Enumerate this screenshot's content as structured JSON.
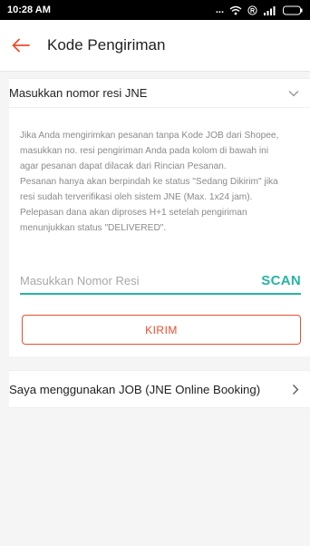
{
  "status_bar": {
    "time": "10:28 AM",
    "dots": "..."
  },
  "header": {
    "title": "Kode Pengiriman"
  },
  "section": {
    "dropdown_label": "Masukkan nomor resi JNE",
    "info_lines": [
      "Jika Anda mengirimkan pesanan tanpa Kode JOB dari Shopee,",
      "masukkan no. resi pengiriman Anda pada kolom di bawah ini",
      "agar pesanan dapat dilacak dari Rincian Pesanan.",
      "Pesanan hanya akan berpindah ke status \"Sedang Dikirim\" jika",
      "resi sudah terverifikasi oleh sistem JNE (Max. 1x24 jam).",
      "Pelepasan dana akan diproses H+1 setelah pengiriman",
      "menunjukkan status \"DELIVERED\"."
    ],
    "resi_placeholder": "Masukkan Nomor Resi",
    "scan_label": "SCAN",
    "kirim_label": "KIRIM"
  },
  "job_option": {
    "label": "Saya menggunakan JOB (JNE Online Booking)"
  },
  "colors": {
    "accent": "#ee4d2d",
    "teal": "#26b5a3"
  }
}
